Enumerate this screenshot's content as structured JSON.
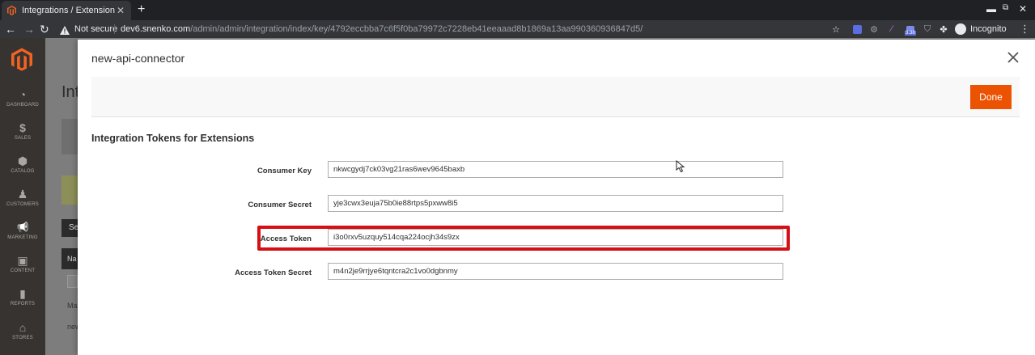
{
  "browser": {
    "tab_title": "Integrations / Extensions",
    "new_tab": "+",
    "not_secure": "Not secure",
    "url_host": "dev6.snenko.com",
    "url_path": "/admin/admin/integration/index/key/4792eccbba7c6f5f0ba79972c7228eb41eeaaad8b1869a13aa990360936847d5/",
    "ext_badge": "3.38",
    "incognito_label": "Incognito"
  },
  "admin_nav": [
    {
      "label": "DASHBOARD",
      "icon": "dashboard-icon",
      "glyph": "◔"
    },
    {
      "label": "SALES",
      "icon": "dollar-icon",
      "glyph": "$"
    },
    {
      "label": "CATALOG",
      "icon": "cube-icon",
      "glyph": "⬢"
    },
    {
      "label": "CUSTOMERS",
      "icon": "person-icon",
      "glyph": "♟"
    },
    {
      "label": "MARKETING",
      "icon": "megaphone-icon",
      "glyph": "📢"
    },
    {
      "label": "CONTENT",
      "icon": "layout-icon",
      "glyph": "▣"
    },
    {
      "label": "REPORTS",
      "icon": "bar-chart-icon",
      "glyph": "▮"
    },
    {
      "label": "STORES",
      "icon": "store-icon",
      "glyph": "⌂"
    }
  ],
  "background": {
    "page_title": "Int",
    "btn_text": "Se",
    "th_text": "Na",
    "row1": "Ma",
    "row2": "new"
  },
  "modal": {
    "title": "new-api-connector",
    "done_label": "Done",
    "section_title": "Integration Tokens for Extensions",
    "fields": [
      {
        "label": "Consumer Key",
        "value": "nkwcgydj7ck03vg21ras6wev9645baxb"
      },
      {
        "label": "Consumer Secret",
        "value": "yje3cwx3euja75b0ie88rtps5pxww8i5"
      },
      {
        "label": "Access Token",
        "value": "i3o0rxv5uzquy514cqa224ocjh34s9zx"
      },
      {
        "label": "Access Token Secret",
        "value": "m4n2je9rrjye6tqntcra2c1vo0dgbnmy"
      }
    ]
  },
  "colors": {
    "accent": "#eb5202",
    "highlight": "#d40f16",
    "admin_nav_bg": "#373330"
  }
}
